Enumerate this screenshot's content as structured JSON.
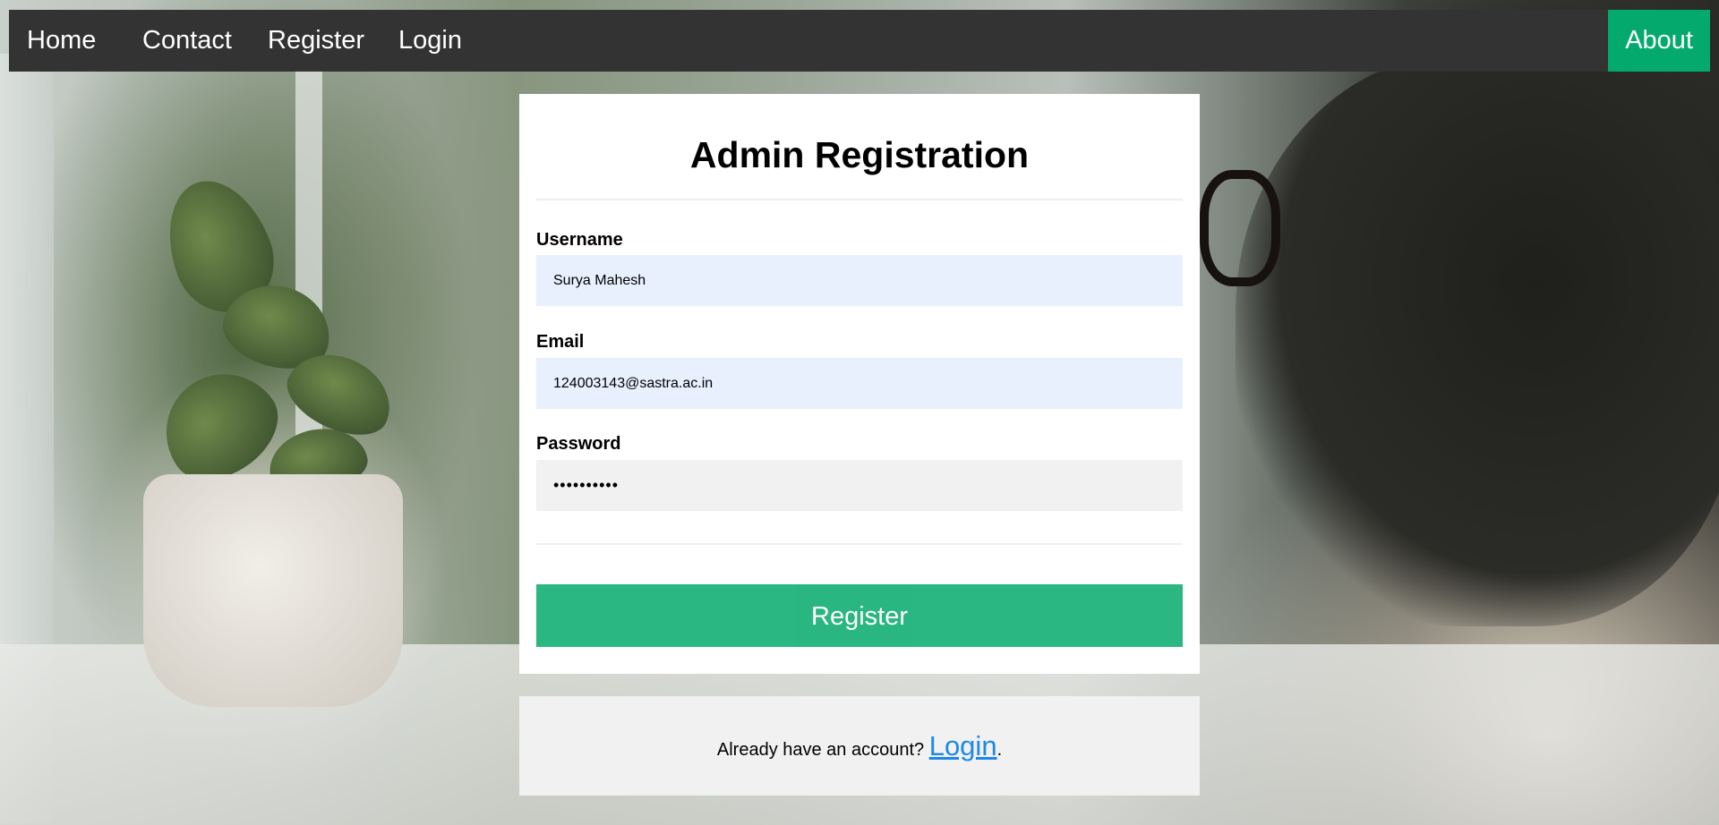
{
  "nav": {
    "items": [
      {
        "label": "Home"
      },
      {
        "label": "Contact"
      },
      {
        "label": "Register"
      },
      {
        "label": "Login"
      }
    ],
    "about_label": "About",
    "about_color": "#04aa6d"
  },
  "form": {
    "title": "Admin Registration",
    "username": {
      "label": "Username",
      "value": "Surya Mahesh"
    },
    "email": {
      "label": "Email",
      "value": "124003143@sastra.ac.in"
    },
    "password": {
      "label": "Password",
      "value": "••••••••••"
    },
    "submit_label": "Register",
    "submit_color": "#1fb37b"
  },
  "signin": {
    "prefix": "Already have an account? ",
    "link_label": "Login",
    "suffix": "."
  }
}
